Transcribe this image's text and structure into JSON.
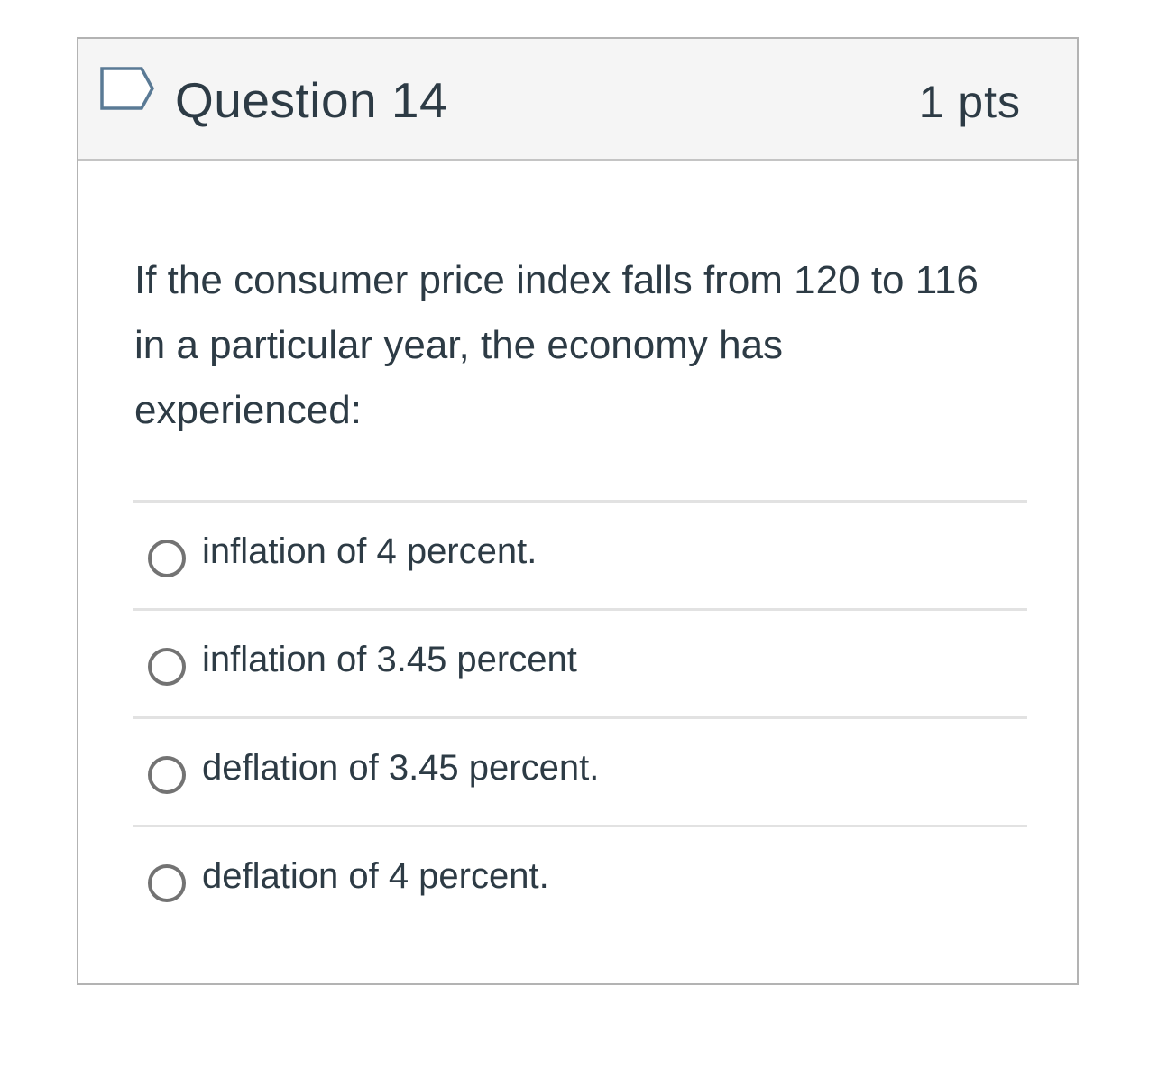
{
  "question": {
    "title": "Question 14",
    "points": "1 pts",
    "flag_icon": "flag-outline-icon",
    "text": "If the consumer price index falls from 120 to 116 in a particular year, the economy has experienced:"
  },
  "answers": [
    {
      "label": "inflation of 4 percent."
    },
    {
      "label": "inflation of 3.45 percent"
    },
    {
      "label": "deflation of 3.45 percent."
    },
    {
      "label": "deflation of 4 percent."
    }
  ],
  "colors": {
    "text": "#2d3b45",
    "header_bg": "#f5f5f5",
    "border": "#b3b3b3",
    "divider": "#e2e2e2",
    "radio_border": "#737373"
  }
}
